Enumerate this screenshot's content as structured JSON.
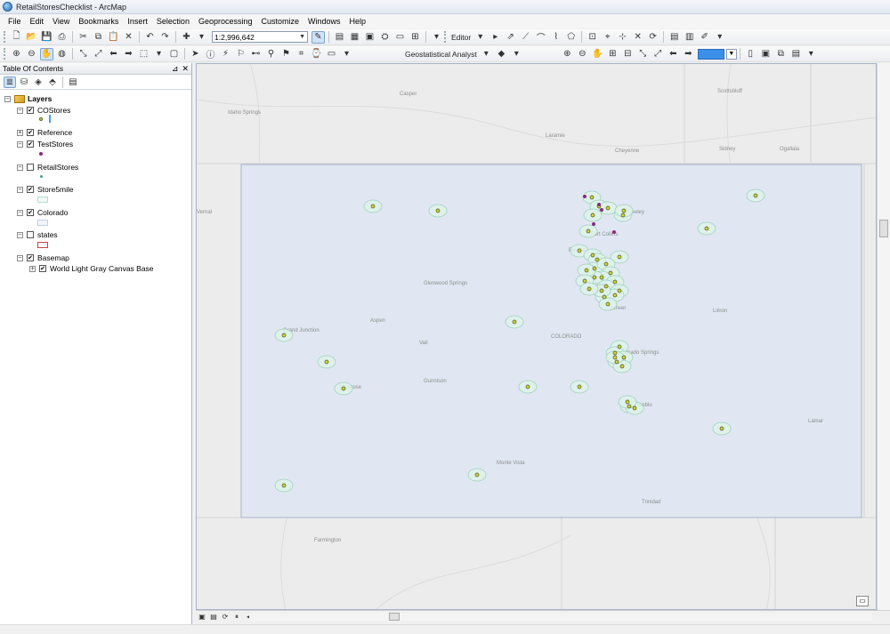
{
  "window": {
    "title": "RetailStoresChecklist - ArcMap"
  },
  "menu": [
    "File",
    "Edit",
    "View",
    "Bookmarks",
    "Insert",
    "Selection",
    "Geoprocessing",
    "Customize",
    "Windows",
    "Help"
  ],
  "toolbar": {
    "scale": "1:2,996,642",
    "editor_label": "Editor",
    "geostat_label": "Geostatistical Analyst"
  },
  "toc": {
    "title": "Table Of Contents",
    "root_label": "Layers",
    "layers": [
      {
        "name": "COStores",
        "checked": true,
        "expanded": true,
        "symbol": "yellow-point"
      },
      {
        "name": "Reference",
        "checked": true,
        "expanded": false
      },
      {
        "name": "TestStores",
        "checked": true,
        "expanded": true,
        "symbol": "purple-point"
      },
      {
        "name": "RetailStores",
        "checked": false,
        "expanded": true,
        "symbol": "teal-point"
      },
      {
        "name": "Store5mile",
        "checked": true,
        "expanded": true,
        "symbol": "light-green-polygon"
      },
      {
        "name": "Colorado",
        "checked": true,
        "expanded": true,
        "symbol": "light-blue-polygon"
      },
      {
        "name": "states",
        "checked": false,
        "expanded": true,
        "symbol": "red-outline-polygon"
      },
      {
        "name": "Basemap",
        "checked": true,
        "expanded": true
      },
      {
        "name": "World Light Gray Canvas Base",
        "checked": true,
        "expanded": false
      }
    ]
  },
  "map": {
    "labels": [
      "Idaho Springs",
      "Casper",
      "Laramie",
      "Cheyenne",
      "Scottsbluff",
      "Sidney",
      "Ogallala",
      "Vernal",
      "Fort Collins",
      "Greeley",
      "Boulder",
      "Denver",
      "Glenwood Springs",
      "Grand Junction",
      "Montrose",
      "Colorado Springs",
      "Pueblo",
      "Gunnison",
      "Monte Vista",
      "Trinidad",
      "Farmington",
      "Lamar",
      "Limon",
      "Aspen",
      "Vail",
      "COLORADO"
    ],
    "colors": {
      "colorado_fill": "#e0e7f2",
      "buffer_fill": "#def2ea",
      "buffer_stroke": "#9fd0bf",
      "store_fill": "#d6d43a",
      "test_fill": "#8b2a7c"
    }
  }
}
